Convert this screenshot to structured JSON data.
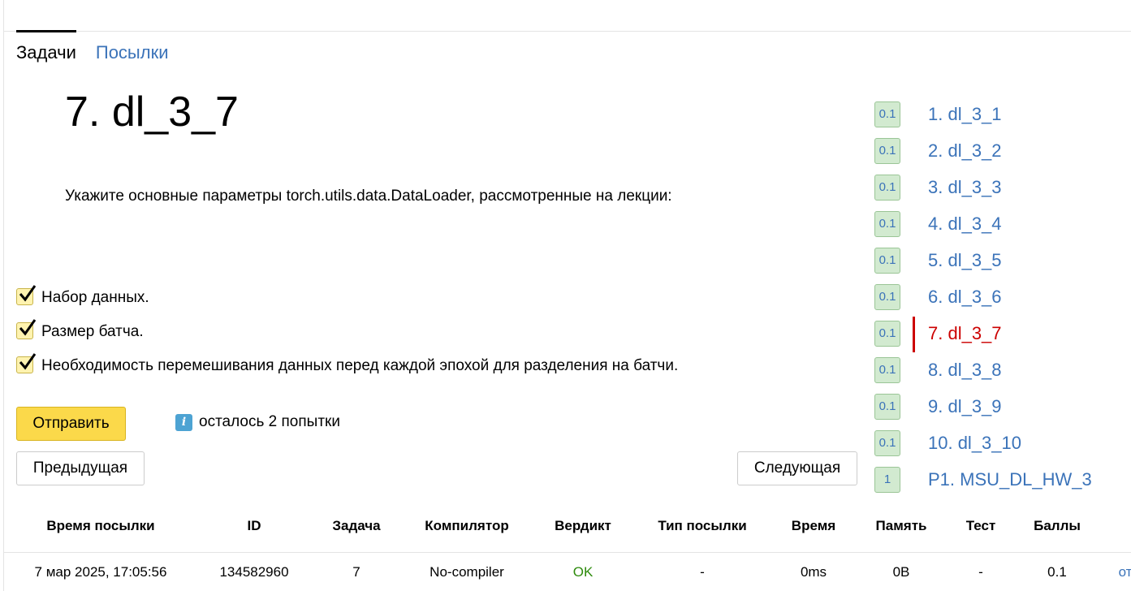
{
  "tabs": [
    {
      "label": "Задачи",
      "active": true
    },
    {
      "label": "Посылки",
      "active": false
    }
  ],
  "problem": {
    "title": "7. dl_3_7",
    "statement": "Укажите основные параметры torch.utils.data.DataLoader, рассмотренные на лекции:",
    "options": [
      {
        "label": "Набор данных.",
        "checked": true
      },
      {
        "label": "Размер батча.",
        "checked": true
      },
      {
        "label": "Необходимость перемешивания данных перед каждой эпохой для разделения на батчи.",
        "checked": true
      }
    ]
  },
  "actions": {
    "submit_label": "Отправить",
    "attempts_text": "осталось 2 попытки",
    "prev_label": "Предыдущая",
    "next_label": "Следующая"
  },
  "problem_list": [
    {
      "score": "0.1",
      "name": "1. dl_3_1"
    },
    {
      "score": "0.1",
      "name": "2. dl_3_2"
    },
    {
      "score": "0.1",
      "name": "3. dl_3_3"
    },
    {
      "score": "0.1",
      "name": "4. dl_3_4"
    },
    {
      "score": "0.1",
      "name": "5. dl_3_5"
    },
    {
      "score": "0.1",
      "name": "6. dl_3_6"
    },
    {
      "score": "0.1",
      "name": "7. dl_3_7",
      "current": true
    },
    {
      "score": "0.1",
      "name": "8. dl_3_8"
    },
    {
      "score": "0.1",
      "name": "9. dl_3_9"
    },
    {
      "score": "0.1",
      "name": "10. dl_3_10"
    },
    {
      "score": "1",
      "name": "P1. MSU_DL_HW_3"
    }
  ],
  "submissions": {
    "headers": [
      "Время посылки",
      "ID",
      "Задача",
      "Компилятор",
      "Вердикт",
      "Тип посылки",
      "Время",
      "Память",
      "Тест",
      "Баллы"
    ],
    "rows": [
      {
        "time": "7 мар 2025, 17:05:56",
        "id": "134582960",
        "task": "7",
        "compiler": "No-compiler",
        "verdict": "OK",
        "type": "-",
        "run_time": "0ms",
        "memory": "0B",
        "test": "-",
        "points": "0.1",
        "extra": "от"
      }
    ]
  },
  "colors": {
    "link": "#3b73b9",
    "current": "#cc0000",
    "verdict_ok": "#2e8b0d",
    "submit_button": "#fbd94a",
    "score_badge": "#d2ead0"
  }
}
